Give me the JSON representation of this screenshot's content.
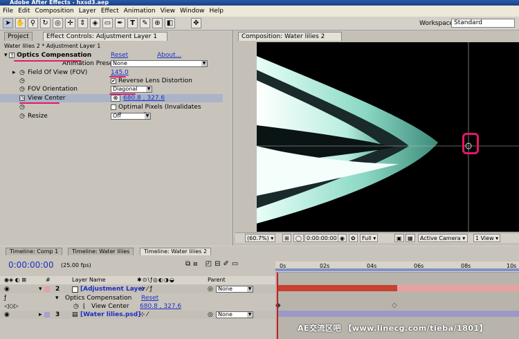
{
  "app": {
    "title": "Adobe After Effects - hxsd3.aep"
  },
  "menu": [
    "File",
    "Edit",
    "Composition",
    "Layer",
    "Effect",
    "Animation",
    "View",
    "Window",
    "Help"
  ],
  "toolbar": {
    "workspace_label": "Workspace:",
    "workspace_value": "Standard"
  },
  "left_panel": {
    "tabs": [
      "Project",
      "Effect Controls: Adjustment Layer 1"
    ],
    "breadcrumb": "Water lilies 2 * Adjustment Layer 1",
    "effect_name": "Optics Compensation",
    "reset": "Reset",
    "about": "About...",
    "presets_label": "Animation Presets:",
    "presets_value": "None",
    "fov_label": "Field Of View (FOV)",
    "fov_value": "145.0",
    "reverse_label": "Reverse Lens Distortion",
    "orientation_label": "FOV Orientation",
    "orientation_value": "Diagonal",
    "view_center_label": "View Center",
    "view_center_value": "680.8 , 327.6",
    "optimal_label": "Optimal Pixels (Invalidates Reversal)",
    "resize_label": "Resize",
    "resize_value": "Off"
  },
  "comp_panel": {
    "tab": "Composition: Water lilies 2",
    "zoom": "(60.7%)",
    "timecode": "0:00:00:00",
    "resolution": "Full",
    "camera": "Active Camera",
    "views": "1 View"
  },
  "timeline": {
    "tabs": [
      "Timeline: Comp 1",
      "Timeline: Water lilies",
      "Timeline: Water lilies 2"
    ],
    "timecode": "0:00:00:00",
    "fps": "(25.00 fps)",
    "col_num": "#",
    "col_layer_name": "Layer Name",
    "col_parent": "Parent",
    "ruler": [
      "0s",
      "02s",
      "04s",
      "06s",
      "08s",
      "10s"
    ],
    "layers": [
      {
        "num": "2",
        "name": "[Adjustment Layer",
        "parent": "None"
      },
      {
        "num": "3",
        "name": "[Water lilies.psd]",
        "parent": "None"
      }
    ],
    "effect_row": "Optics Compensation",
    "effect_reset": "Reset",
    "prop_name": "View Center",
    "prop_value": "680.8 , 327.6",
    "watermark": "AE交流区吧 【www.linecg.com/tieba/1801】"
  },
  "colors": {
    "accent": "#e5176a",
    "link": "#1c2fc2",
    "timecode": "#1c2fc2",
    "bar_red": "#c84030",
    "bar_purple": "#9c98c8"
  }
}
